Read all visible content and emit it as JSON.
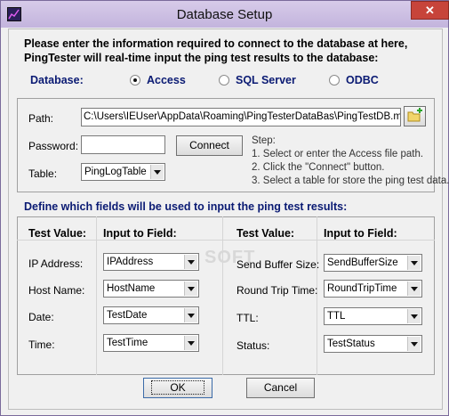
{
  "window": {
    "title": "Database Setup",
    "close_glyph": "✕"
  },
  "intro": {
    "line1": "Please enter the information required to connect to the database at here,",
    "line2": "PingTester will real-time input the ping test results to the database:"
  },
  "database": {
    "label": "Database:",
    "options": [
      {
        "label": "Access",
        "checked": true
      },
      {
        "label": "SQL Server",
        "checked": false
      },
      {
        "label": "ODBC",
        "checked": false
      }
    ]
  },
  "connection": {
    "path_label": "Path:",
    "path_value": "C:\\Users\\IEUser\\AppData\\Roaming\\PingTesterDataBas\\PingTestDB.mdb",
    "browse_icon": "folder-add-icon",
    "password_label": "Password:",
    "password_value": "",
    "connect_label": "Connect",
    "table_label": "Table:",
    "table_value": "PingLogTable",
    "steps_title": "Step:",
    "steps": [
      "1. Select or enter the Access file path.",
      "2. Click the \"Connect\" button.",
      "3. Select a table for store the ping test data."
    ]
  },
  "fields": {
    "title": "Define which fields will be used to input the ping test results:",
    "col_test_value": "Test Value:",
    "col_input_field": "Input to Field:",
    "left": [
      {
        "label": "IP Address:",
        "field": "IPAddress"
      },
      {
        "label": "Host Name:",
        "field": "HostName"
      },
      {
        "label": "Date:",
        "field": "TestDate"
      },
      {
        "label": "Time:",
        "field": "TestTime"
      }
    ],
    "right": [
      {
        "label": "Send Buffer Size:",
        "field": "SendBufferSize"
      },
      {
        "label": "Round Trip Time:",
        "field": "RoundTripTime"
      },
      {
        "label": "TTL:",
        "field": "TTL"
      },
      {
        "label": "Status:",
        "field": "TestStatus"
      }
    ],
    "watermark": "SOFT"
  },
  "buttons": {
    "ok": "OK",
    "cancel": "Cancel"
  }
}
